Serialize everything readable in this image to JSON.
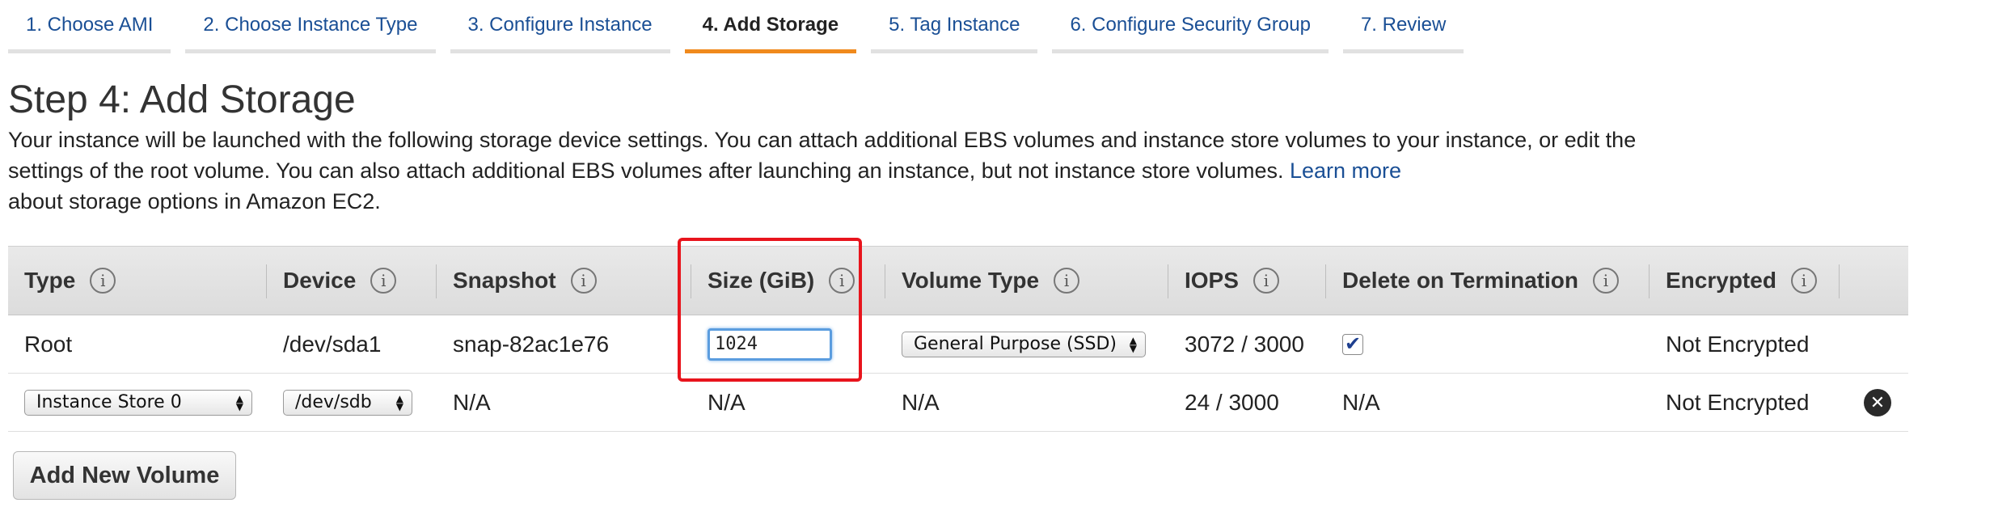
{
  "wizard": {
    "tabs": [
      {
        "label": "1. Choose AMI"
      },
      {
        "label": "2. Choose Instance Type"
      },
      {
        "label": "3. Configure Instance"
      },
      {
        "label": "4. Add Storage"
      },
      {
        "label": "5. Tag Instance"
      },
      {
        "label": "6. Configure Security Group"
      },
      {
        "label": "7. Review"
      }
    ],
    "active_index": 3
  },
  "page": {
    "title": "Step 4: Add Storage",
    "intro": "Your instance will be launched with the following storage device settings. You can attach additional EBS volumes and instance store volumes to your instance, or edit the settings of the root volume. You can also attach additional EBS volumes after launching an instance, but not instance store volumes.",
    "learn_more": "Learn more",
    "intro_suffix": "about storage options in Amazon EC2."
  },
  "table": {
    "columns": [
      "Type",
      "Device",
      "Snapshot",
      "Size (GiB)",
      "Volume Type",
      "IOPS",
      "Delete on Termination",
      "Encrypted"
    ],
    "info_glyph": "i",
    "rows": [
      {
        "type": "Root",
        "device": "/dev/sda1",
        "snapshot": "snap-82ac1e76",
        "size": "1024",
        "volume_type": "General Purpose (SSD)",
        "iops": "3072 / 3000",
        "delete_on_termination": true,
        "encrypted": "Not Encrypted"
      },
      {
        "type": "Instance Store 0",
        "device": "/dev/sdb",
        "snapshot": "N/A",
        "size": "N/A",
        "volume_type": "N/A",
        "iops": "24 / 3000",
        "delete_on_termination": "N/A",
        "encrypted": "Not Encrypted"
      }
    ]
  },
  "actions": {
    "add_volume": "Add New Volume"
  },
  "icons": {
    "info": "info-icon",
    "remove": "remove-volume-icon",
    "check": "checkmark-icon"
  },
  "colors": {
    "link": "#1a4f95",
    "active_tab_underline": "#f08a1d",
    "highlight": "#e8141c"
  }
}
